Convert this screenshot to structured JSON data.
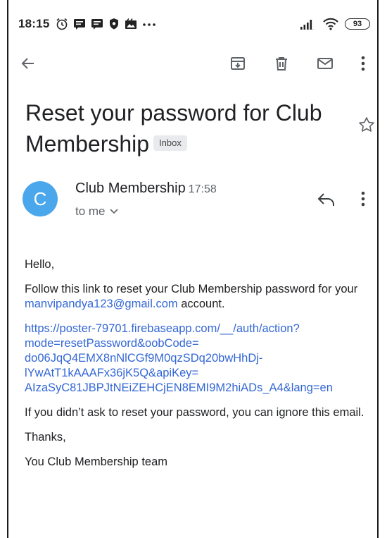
{
  "status_bar": {
    "time": "18:15",
    "battery": "93",
    "icons": [
      "alarm-icon",
      "message-icon",
      "message-icon",
      "shield-icon",
      "gallery-icon",
      "more-horizontal-icon",
      "signal-icon",
      "wifi-icon",
      "battery-icon"
    ]
  },
  "toolbar": {
    "icons": [
      "back-arrow-icon",
      "archive-icon",
      "delete-icon",
      "mail-icon",
      "more-vertical-icon"
    ]
  },
  "email": {
    "subject_line1": "Reset your password for Club",
    "subject_line2": "Membership",
    "label": "Inbox",
    "sender": {
      "avatar_letter": "C",
      "name": "Club Membership",
      "time": "17:58",
      "recipient": "to me"
    },
    "body": {
      "greeting": "Hello,",
      "line1_start": "Follow this link to reset your Club Membership password for your ",
      "email_link": "manvipandya123@gmail.com",
      "line1_end": " account.",
      "url_lines": [
        "https://poster-79701.firebaseapp.com/__/auth/action?",
        "mode=resetPassword&oobCode=",
        "do06JqQ4EMX8nNlCGf9M0qzSDq20bwHhDj-",
        "lYwAtT1kAAAFx36jK5Q&apiKey=",
        "AIzaSyC81JBPJtNEiZEHCjEN8EMI9M2hiADs_A4&lang=en"
      ],
      "ignore_note": "If you didn’t ask to reset your password, you can ignore this email.",
      "thanks": "Thanks,",
      "signature": "You Club Membership team"
    }
  },
  "colors": {
    "avatar": "#4aa7ec",
    "link": "#3367d6",
    "badge_bg": "#e8eaed"
  }
}
